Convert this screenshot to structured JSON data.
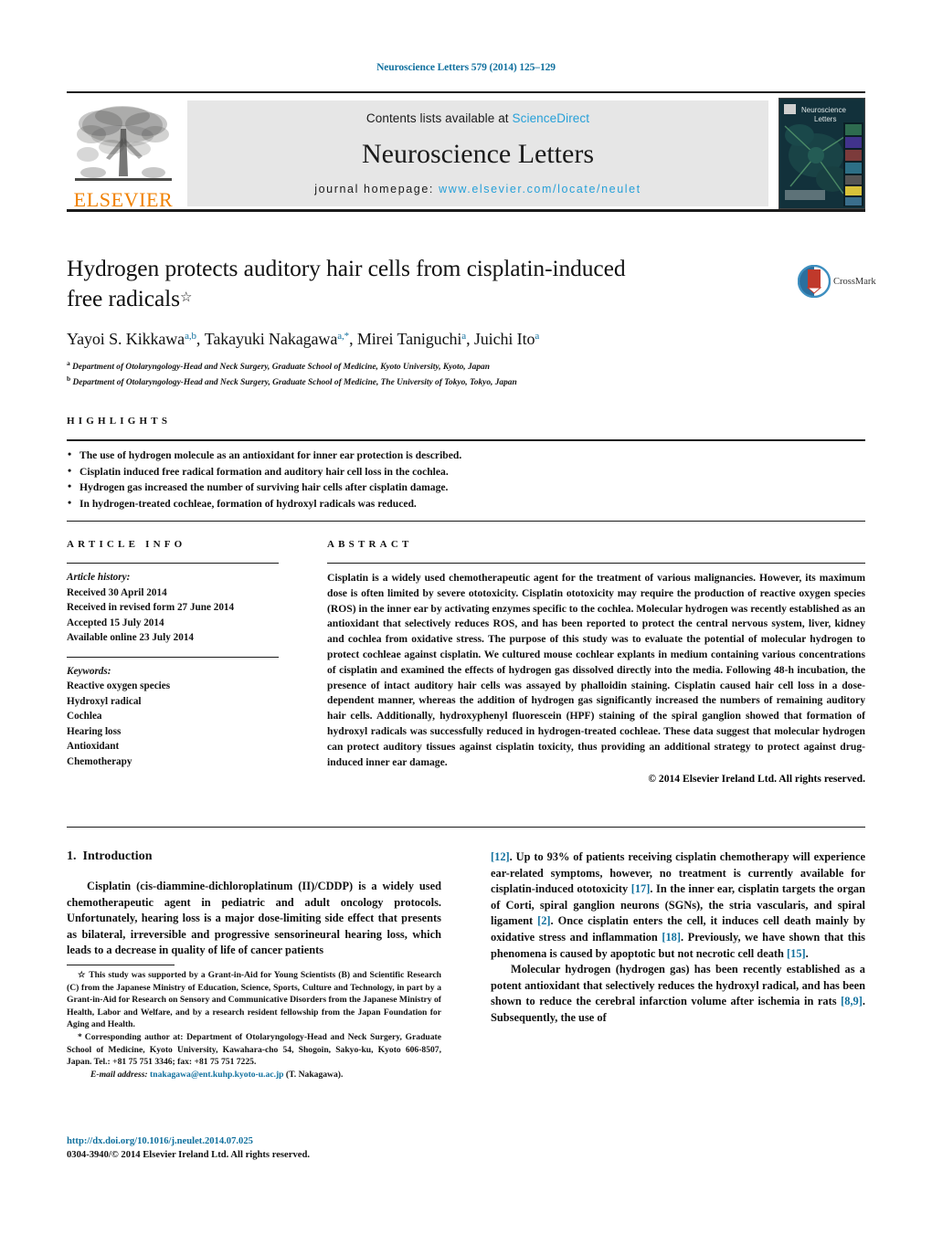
{
  "runhead": "Neuroscience Letters 579 (2014) 125–129",
  "masthead": {
    "contents_prefix": "Contents lists available at ",
    "sciencedirect": "ScienceDirect",
    "journal_title": "Neuroscience Letters",
    "homepage_prefix": "journal homepage: ",
    "homepage_url": "www.elsevier.com/locate/neulet",
    "publisher": "ELSEVIER",
    "cover_title_line1": "Neuroscience",
    "cover_title_line2": "Letters"
  },
  "article": {
    "title": "Hydrogen protects auditory hair cells from cisplatin-induced free radicals",
    "title_line1": "Hydrogen protects auditory hair cells from cisplatin-induced",
    "title_line2": "free radicals",
    "title_footnote_symbol": "☆",
    "authors": "Yayoi S. Kikkawa a,b, Takayuki Nakagawa a,*, Mirei Taniguchi a, Juichi Ito a",
    "author_list": [
      {
        "name": "Yayoi S. Kikkawa",
        "marks": "a,b"
      },
      {
        "name": "Takayuki Nakagawa",
        "marks": "a,*"
      },
      {
        "name": "Mirei Taniguchi",
        "marks": "a"
      },
      {
        "name": "Juichi Ito",
        "marks": "a"
      }
    ],
    "affiliations": [
      {
        "mark": "a",
        "text": "Department of Otolaryngology-Head and Neck Surgery, Graduate School of Medicine, Kyoto University, Kyoto, Japan"
      },
      {
        "mark": "b",
        "text": "Department of Otolaryngology-Head and Neck Surgery, Graduate School of Medicine, The University of Tokyo, Tokyo, Japan"
      }
    ],
    "crossmark_label": "CrossMark"
  },
  "highlights": {
    "label": "HIGHLIGHTS",
    "items": [
      "The use of hydrogen molecule as an antioxidant for inner ear protection is described.",
      "Cisplatin induced free radical formation and auditory hair cell loss in the cochlea.",
      "Hydrogen gas increased the number of surviving hair cells after cisplatin damage.",
      "In hydrogen-treated cochleae, formation of hydroxyl radicals was reduced."
    ]
  },
  "article_info": {
    "label": "ARTICLE INFO",
    "history_label": "Article history:",
    "history": [
      "Received 30 April 2014",
      "Received in revised form 27 June 2014",
      "Accepted 15 July 2014",
      "Available online 23 July 2014"
    ],
    "keywords_label": "Keywords:",
    "keywords": [
      "Reactive oxygen species",
      "Hydroxyl radical",
      "Cochlea",
      "Hearing loss",
      "Antioxidant",
      "Chemotherapy"
    ]
  },
  "abstract": {
    "label": "ABSTRACT",
    "text": "Cisplatin is a widely used chemotherapeutic agent for the treatment of various malignancies. However, its maximum dose is often limited by severe ototoxicity. Cisplatin ototoxicity may require the production of reactive oxygen species (ROS) in the inner ear by activating enzymes specific to the cochlea. Molecular hydrogen was recently established as an antioxidant that selectively reduces ROS, and has been reported to protect the central nervous system, liver, kidney and cochlea from oxidative stress. The purpose of this study was to evaluate the potential of molecular hydrogen to protect cochleae against cisplatin. We cultured mouse cochlear explants in medium containing various concentrations of cisplatin and examined the effects of hydrogen gas dissolved directly into the media. Following 48-h incubation, the presence of intact auditory hair cells was assayed by phalloidin staining. Cisplatin caused hair cell loss in a dose-dependent manner, whereas the addition of hydrogen gas significantly increased the numbers of remaining auditory hair cells. Additionally, hydroxyphenyl fluorescein (HPF) staining of the spiral ganglion showed that formation of hydroxyl radicals was successfully reduced in hydrogen-treated cochleae. These data suggest that molecular hydrogen can protect auditory tissues against cisplatin toxicity, thus providing an additional strategy to protect against drug-induced inner ear damage.",
    "copyright": "© 2014 Elsevier Ireland Ltd. All rights reserved."
  },
  "introduction": {
    "number": "1.",
    "heading": "Introduction",
    "para1_part1": "Cisplatin (cis-diammine-dichloroplatinum (II)/CDDP) is a widely used chemotherapeutic agent in pediatric and adult oncology protocols. Unfortunately, hearing loss is a major dose-limiting side effect that presents as bilateral, irreversible and progressive sensorineural hearing loss, which leads to a decrease in quality of life of cancer patients ",
    "ref12": "[12]",
    "para1_part2": ". Up to 93% of patients receiving cisplatin chemotherapy will experience ear-related symptoms, however, no treatment is currently available for cisplatin-induced ototoxicity ",
    "ref17": "[17]",
    "para1_part3": ". In the inner ear, cisplatin targets the organ of Corti, spiral ganglion neurons (SGNs), the stria vascularis, and spiral ligament ",
    "ref2": "[2]",
    "para1_part4": ". Once cisplatin enters the cell, it induces cell death mainly by oxidative stress and inflammation ",
    "ref18": "[18]",
    "para1_part5": ". Previously, we have shown that this phenomena is caused by apoptotic but not necrotic cell death ",
    "ref15": "[15]",
    "para1_part6": ".",
    "para2_part1": "Molecular hydrogen (hydrogen gas) has been recently established as a potent antioxidant that selectively reduces the hydroxyl radical, and has been shown to reduce the cerebral infarction volume after ischemia in rats ",
    "ref89": "[8,9]",
    "para2_part2": ". Subsequently, the use of"
  },
  "footnotes": {
    "funding_symbol": "☆",
    "funding": "This study was supported by a Grant-in-Aid for Young Scientists (B) and Scientific Research (C) from the Japanese Ministry of Education, Science, Sports, Culture and Technology, in part by a Grant-in-Aid for Research on Sensory and Communicative Disorders from the Japanese Ministry of Health, Labor and Welfare, and by a research resident fellowship from the Japan Foundation for Aging and Health.",
    "corresponding_symbol": "*",
    "corresponding": "Corresponding author at: Department of Otolaryngology-Head and Neck Surgery, Graduate School of Medicine, Kyoto University, Kawahara-cho 54, Shogoin, Sakyo-ku, Kyoto 606-8507, Japan. Tel.: +81 75 751 3346; fax: +81 75 751 7225.",
    "email_label": "E-mail address:",
    "email": "tnakagawa@ent.kuhp.kyoto-u.ac.jp",
    "email_suffix": "(T. Nakagawa)."
  },
  "doi": {
    "url": "http://dx.doi.org/10.1016/j.neulet.2014.07.025",
    "issn_line": "0304-3940/© 2014 Elsevier Ireland Ltd. All rights reserved."
  },
  "colors": {
    "link": "#10709e",
    "sciencedirect": "#27a0d8",
    "elsevier_orange": "#f08000",
    "masthead_bg": "#e6e6e6"
  }
}
